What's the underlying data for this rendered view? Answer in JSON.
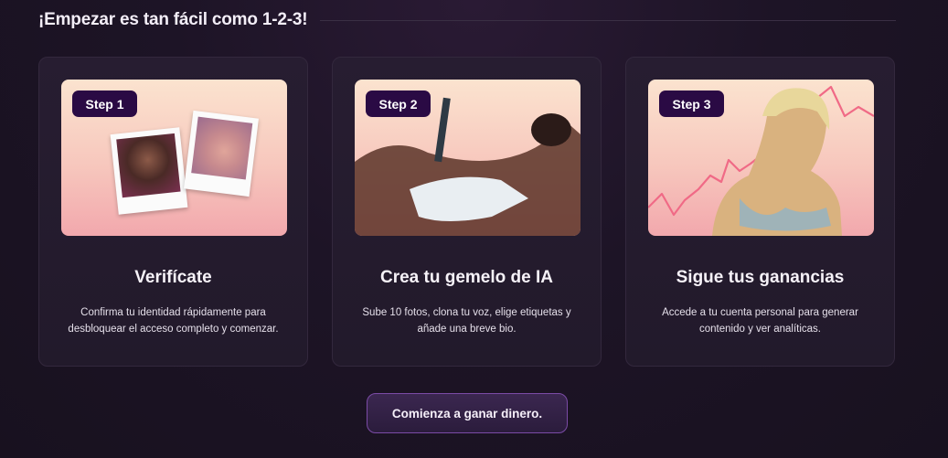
{
  "header": {
    "title": "¡Empezar es tan fácil como 1-2-3!"
  },
  "steps": [
    {
      "badge": "Step 1",
      "title": "Verifícate",
      "description": "Confirma tu identidad rápidamente para desbloquear el acceso completo y comenzar."
    },
    {
      "badge": "Step 2",
      "title": "Crea tu gemelo de IA",
      "description": "Sube 10 fotos, clona tu voz, elige etiquetas y añade una breve bio."
    },
    {
      "badge": "Step 3",
      "title": "Sigue tus ganancias",
      "description": "Accede a tu cuenta personal para generar contenido y ver analíticas."
    }
  ],
  "cta": {
    "label": "Comienza a ganar dinero."
  },
  "colors": {
    "background": "#1d1426",
    "badge": "#2a0a44",
    "cta_border": "#7b4ba6",
    "chart_line": "#f06a86"
  }
}
